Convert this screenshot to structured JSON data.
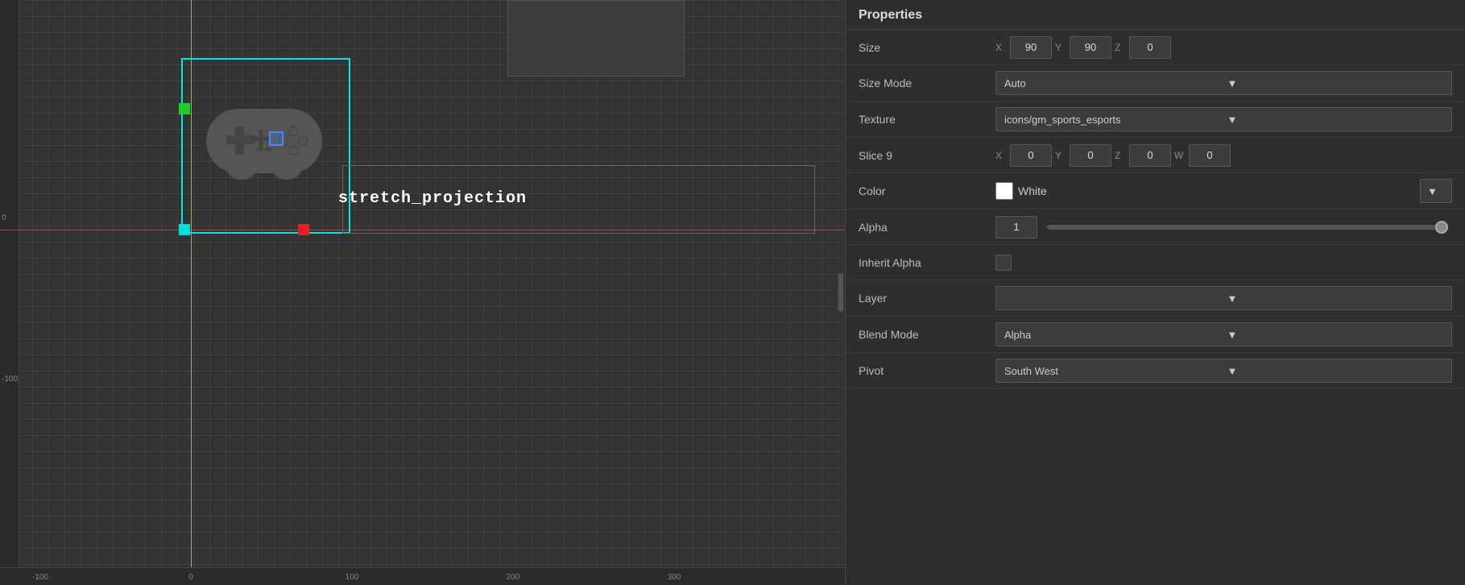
{
  "panel": {
    "title": "Properties"
  },
  "properties": {
    "size": {
      "label": "Size",
      "x_label": "X",
      "x_value": "90",
      "y_label": "Y",
      "y_value": "90",
      "z_label": "Z",
      "z_value": "0"
    },
    "size_mode": {
      "label": "Size Mode",
      "value": "Auto"
    },
    "texture": {
      "label": "Texture",
      "value": "icons/gm_sports_esports"
    },
    "slice9": {
      "label": "Slice 9",
      "x_label": "X",
      "x_value": "0",
      "y_label": "Y",
      "y_value": "0",
      "z_label": "Z",
      "z_value": "0",
      "w_label": "W",
      "w_value": "0"
    },
    "color": {
      "label": "Color",
      "value": "White",
      "swatch": "#ffffff"
    },
    "alpha": {
      "label": "Alpha",
      "value": "1"
    },
    "inherit_alpha": {
      "label": "Inherit Alpha"
    },
    "layer": {
      "label": "Layer",
      "value": ""
    },
    "blend_mode": {
      "label": "Blend Mode",
      "value": "Alpha"
    },
    "pivot": {
      "label": "Pivot",
      "value": "South West"
    }
  },
  "canvas": {
    "stretch_label": "stretch_projection",
    "ruler_h_ticks": [
      "-100",
      "0",
      "100",
      "200",
      "300"
    ],
    "ruler_v_ticks": [
      "0",
      "-100"
    ]
  }
}
